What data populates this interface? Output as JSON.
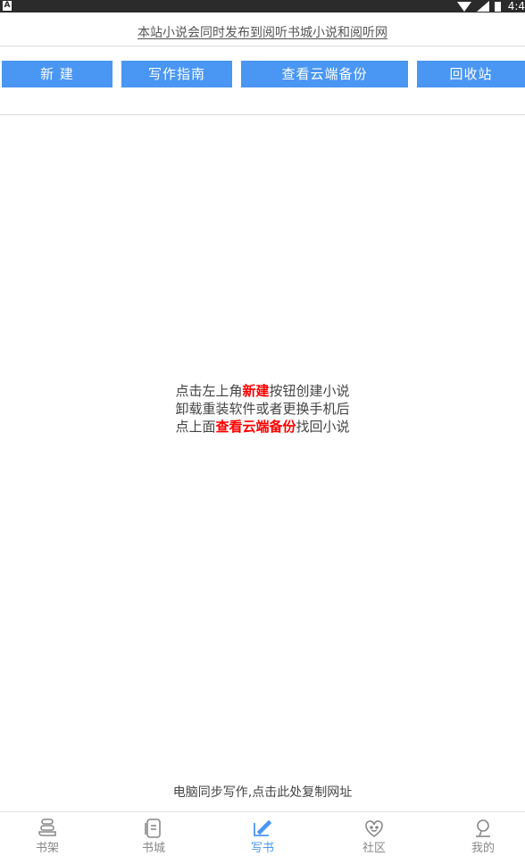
{
  "status_bar": {
    "time": "4:4"
  },
  "notice": {
    "text": "本站小说会同时发布到阅听书城小说和阅听网"
  },
  "toolbar": {
    "new_label": "新 建",
    "guide_label": "写作指南",
    "cloud_backup_label": "查看云端备份",
    "recycle_label": "回收站"
  },
  "hint": {
    "line1_pre": "点击左上角",
    "line1_red": "新建",
    "line1_post": "按钮创建小说",
    "line2": "卸载重装软件或者更换手机后",
    "line3_pre": "点上面",
    "line3_red": "查看云端备份",
    "line3_post": "找回小说"
  },
  "copy_link": {
    "text": "电脑同步写作,点击此处复制网址"
  },
  "tabs": [
    {
      "label": "书架",
      "icon": "bookshelf-icon",
      "active": false
    },
    {
      "label": "书城",
      "icon": "bookstore-icon",
      "active": false
    },
    {
      "label": "写书",
      "icon": "write-icon",
      "active": true
    },
    {
      "label": "社区",
      "icon": "community-icon",
      "active": false
    },
    {
      "label": "我的",
      "icon": "profile-icon",
      "active": false
    }
  ],
  "colors": {
    "accent": "#4a96f3",
    "highlight": "#ff0000",
    "statusbar": "#2b2b2b"
  }
}
